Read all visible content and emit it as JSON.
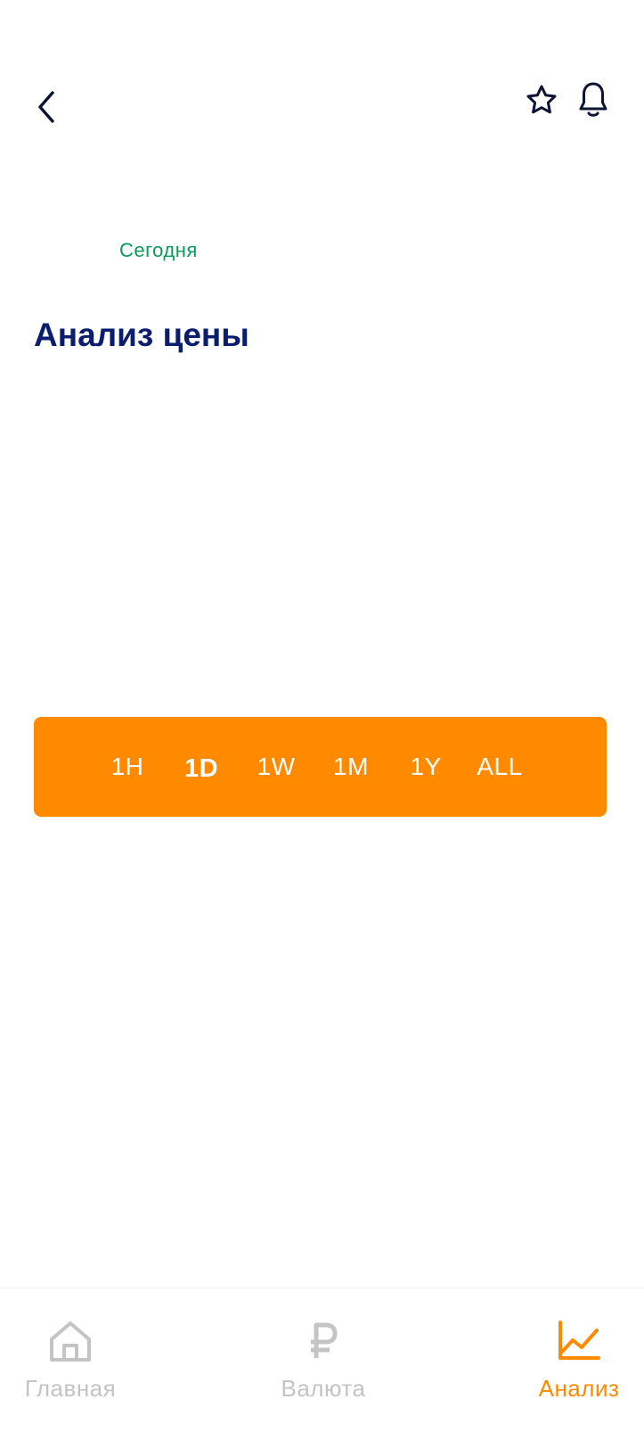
{
  "header": {
    "back_icon": "chevron-left-icon",
    "favorite_icon": "star-outline-icon",
    "notifications_icon": "bell-outline-icon"
  },
  "date_label": "Сегодня",
  "section_title": "Анализ цены",
  "timeframes": {
    "selected": "1D",
    "options": [
      "1H",
      "1D",
      "1W",
      "1M",
      "1Y",
      "ALL"
    ]
  },
  "bottom_nav": {
    "items": [
      {
        "label": "Главная",
        "icon": "home-icon",
        "active": false
      },
      {
        "label": "Валюта",
        "icon": "ruble-icon",
        "active": false
      },
      {
        "label": "Анализ",
        "icon": "chart-line-icon",
        "active": true
      }
    ]
  },
  "colors": {
    "accent": "#ff8a00",
    "title": "#0b1d6e",
    "date": "#0a9a5a",
    "inactive": "#c4c4c4"
  }
}
